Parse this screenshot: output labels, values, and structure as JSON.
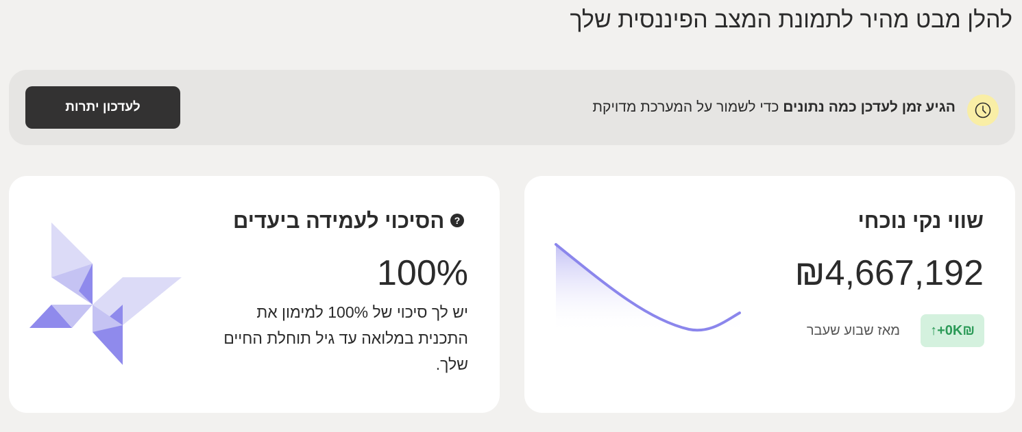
{
  "page": {
    "heading": "להלן מבט מהיר לתמונת המצב הפיננסית שלך"
  },
  "banner": {
    "bold_text": "הגיע זמן לעדכן כמה נתונים",
    "text": " כדי לשמור על המערכת מדויקת",
    "button_label": "לעדכון יתרות",
    "icon": "clock-icon",
    "icon_bg": "#f9eea6"
  },
  "net_worth": {
    "title": "שווי נקי נוכחי",
    "value": "₪4,667,192",
    "change": "↑+0K₪",
    "change_label": "מאז שבוע שעבר",
    "change_color": "#2b9a57",
    "line_color": "#8b86ec"
  },
  "success": {
    "title": "הסיכוי לעמידה ביעדים",
    "help_icon": "?",
    "value": "100%",
    "description": "יש לך סיכוי של 100% למימון את התכנית במלואה עד גיל תוחלת החיים שלך."
  }
}
